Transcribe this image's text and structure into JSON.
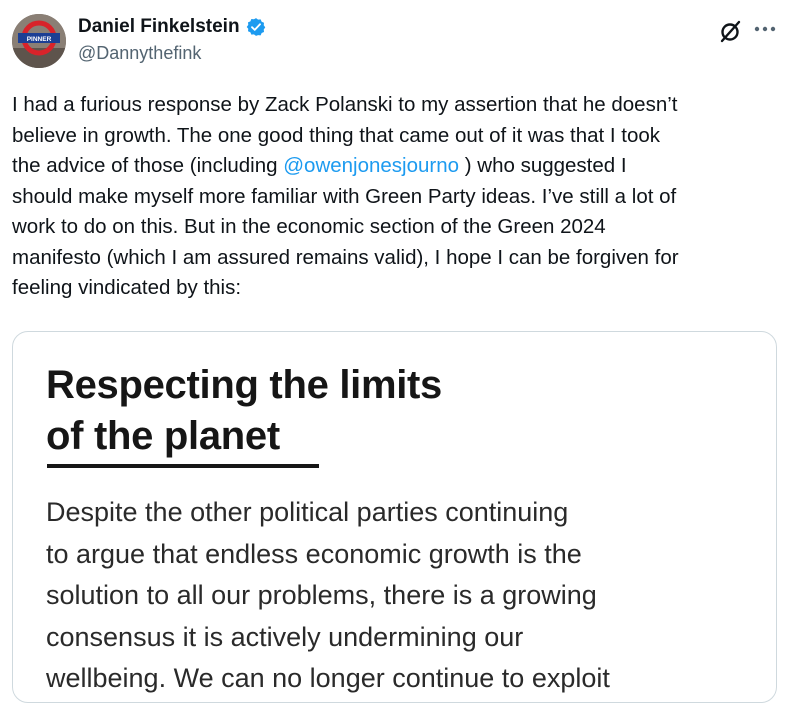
{
  "author": {
    "display_name": "Daniel Finkelstein",
    "handle": "@Dannythefink",
    "avatar_badge_text": "PINNER",
    "verified": true
  },
  "icons": {
    "verified": "verified-badge-icon",
    "grok": "grok-icon",
    "more": "more-horizontal-icon"
  },
  "colors": {
    "link": "#1d9bf0",
    "verified_badge": "#1d9bf0",
    "secondary_text": "#536471"
  },
  "tweet": {
    "lines": [
      "I had a furious response by Zack Polanski to my assertion that he doesn’t",
      "believe in growth. The one good thing that came out of it was that I took",
      {
        "before": "the advice of those (including ",
        "mention": "@owenjonesjourno",
        "after": " ) who suggested I"
      },
      "should make myself more familiar with Green Party ideas. I’ve still a lot of",
      "work to do on this. But in the economic section of the Green 2024",
      "manifesto (which I am assured remains valid), I hope I can be forgiven for",
      "feeling vindicated by this:"
    ]
  },
  "media": {
    "heading_lines": [
      "Respecting the limits",
      "of the planet"
    ],
    "body_lines": [
      "Despite the other political parties continuing",
      "to argue that endless economic growth is the",
      "solution to all our problems, there is a growing",
      "consensus it is actively undermining our",
      "wellbeing. We can no longer continue to exploit"
    ]
  }
}
